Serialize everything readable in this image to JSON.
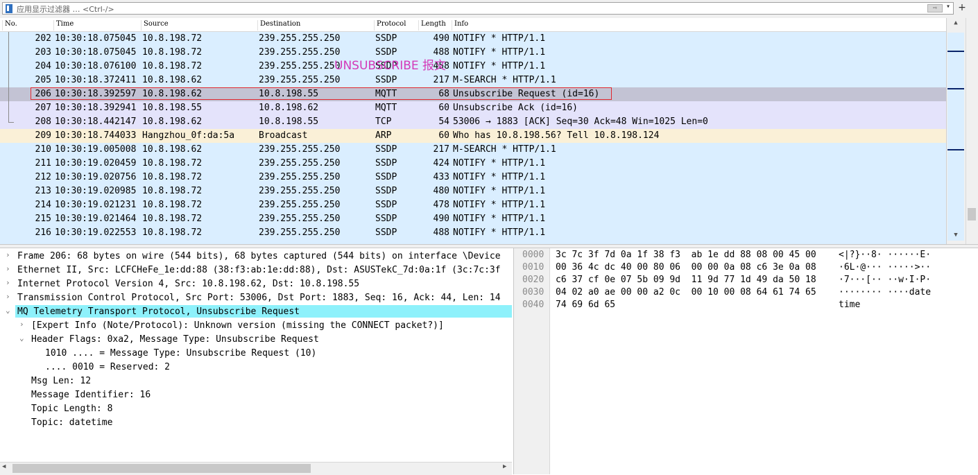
{
  "filter": {
    "placeholder": "应用显示过滤器 … <Ctrl-/>",
    "apply_label": "⇨",
    "add_label": "+"
  },
  "columns": [
    "No.",
    "Time",
    "Source",
    "Destination",
    "Protocol",
    "Length",
    "Info"
  ],
  "packets": [
    {
      "no": "202",
      "time": "10:30:18.075045",
      "src": "10.8.198.72",
      "dst": "239.255.255.250",
      "proto": "SSDP",
      "len": "490",
      "info": "NOTIFY * HTTP/1.1",
      "kind": "ssdp"
    },
    {
      "no": "203",
      "time": "10:30:18.075045",
      "src": "10.8.198.72",
      "dst": "239.255.255.250",
      "proto": "SSDP",
      "len": "488",
      "info": "NOTIFY * HTTP/1.1",
      "kind": "ssdp"
    },
    {
      "no": "204",
      "time": "10:30:18.076100",
      "src": "10.8.198.72",
      "dst": "239.255.255.250",
      "proto": "SSDP",
      "len": "458",
      "info": "NOTIFY * HTTP/1.1",
      "kind": "ssdp"
    },
    {
      "no": "205",
      "time": "10:30:18.372411",
      "src": "10.8.198.62",
      "dst": "239.255.255.250",
      "proto": "SSDP",
      "len": "217",
      "info": "M-SEARCH * HTTP/1.1",
      "kind": "ssdp"
    },
    {
      "no": "206",
      "time": "10:30:18.392597",
      "src": "10.8.198.62",
      "dst": "10.8.198.55",
      "proto": "MQTT",
      "len": "68",
      "info": "Unsubscribe Request (id=16)",
      "kind": "sel"
    },
    {
      "no": "207",
      "time": "10:30:18.392941",
      "src": "10.8.198.55",
      "dst": "10.8.198.62",
      "proto": "MQTT",
      "len": "60",
      "info": "Unsubscribe Ack (id=16)",
      "kind": "mqtt"
    },
    {
      "no": "208",
      "time": "10:30:18.442147",
      "src": "10.8.198.62",
      "dst": "10.8.198.55",
      "proto": "TCP",
      "len": "54",
      "info": "53006 → 1883 [ACK] Seq=30 Ack=48 Win=1025 Len=0",
      "kind": "tcp"
    },
    {
      "no": "209",
      "time": "10:30:18.744033",
      "src": "Hangzhou_0f:da:5a",
      "dst": "Broadcast",
      "proto": "ARP",
      "len": "60",
      "info": "Who has 10.8.198.56? Tell 10.8.198.124",
      "kind": "arp"
    },
    {
      "no": "210",
      "time": "10:30:19.005008",
      "src": "10.8.198.62",
      "dst": "239.255.255.250",
      "proto": "SSDP",
      "len": "217",
      "info": "M-SEARCH * HTTP/1.1",
      "kind": "ssdp"
    },
    {
      "no": "211",
      "time": "10:30:19.020459",
      "src": "10.8.198.72",
      "dst": "239.255.255.250",
      "proto": "SSDP",
      "len": "424",
      "info": "NOTIFY * HTTP/1.1",
      "kind": "ssdp"
    },
    {
      "no": "212",
      "time": "10:30:19.020756",
      "src": "10.8.198.72",
      "dst": "239.255.255.250",
      "proto": "SSDP",
      "len": "433",
      "info": "NOTIFY * HTTP/1.1",
      "kind": "ssdp"
    },
    {
      "no": "213",
      "time": "10:30:19.020985",
      "src": "10.8.198.72",
      "dst": "239.255.255.250",
      "proto": "SSDP",
      "len": "480",
      "info": "NOTIFY * HTTP/1.1",
      "kind": "ssdp"
    },
    {
      "no": "214",
      "time": "10:30:19.021231",
      "src": "10.8.198.72",
      "dst": "239.255.255.250",
      "proto": "SSDP",
      "len": "478",
      "info": "NOTIFY * HTTP/1.1",
      "kind": "ssdp"
    },
    {
      "no": "215",
      "time": "10:30:19.021464",
      "src": "10.8.198.72",
      "dst": "239.255.255.250",
      "proto": "SSDP",
      "len": "490",
      "info": "NOTIFY * HTTP/1.1",
      "kind": "ssdp"
    },
    {
      "no": "216",
      "time": "10:30:19.022553",
      "src": "10.8.198.72",
      "dst": "239.255.255.250",
      "proto": "SSDP",
      "len": "488",
      "info": "NOTIFY * HTTP/1.1",
      "kind": "ssdp"
    }
  ],
  "details": [
    {
      "indent": 0,
      "toggle": "›",
      "text": "Frame 206: 68 bytes on wire (544 bits), 68 bytes captured (544 bits) on interface \\Device"
    },
    {
      "indent": 0,
      "toggle": "›",
      "text": "Ethernet II, Src: LCFCHeFe_1e:dd:88 (38:f3:ab:1e:dd:88), Dst: ASUSTekC_7d:0a:1f (3c:7c:3f"
    },
    {
      "indent": 0,
      "toggle": "›",
      "text": "Internet Protocol Version 4, Src: 10.8.198.62, Dst: 10.8.198.55"
    },
    {
      "indent": 0,
      "toggle": "›",
      "text": "Transmission Control Protocol, Src Port: 53006, Dst Port: 1883, Seq: 16, Ack: 44, Len: 14"
    },
    {
      "indent": 0,
      "toggle": "⌄",
      "text": "MQ Telemetry Transport Protocol, Unsubscribe Request"
    },
    {
      "indent": 1,
      "toggle": "›",
      "text": "[Expert Info (Note/Protocol): Unknown version (missing the CONNECT packet?)]"
    },
    {
      "indent": 1,
      "toggle": "⌄",
      "text": "Header Flags: 0xa2, Message Type: Unsubscribe Request"
    },
    {
      "indent": 2,
      "toggle": "",
      "text": "1010 .... = Message Type: Unsubscribe Request (10)"
    },
    {
      "indent": 2,
      "toggle": "",
      "text": ".... 0010 = Reserved: 2"
    },
    {
      "indent": 1,
      "toggle": "",
      "text": "Msg Len: 12"
    },
    {
      "indent": 1,
      "toggle": "",
      "text": "Message Identifier: 16"
    },
    {
      "indent": 1,
      "toggle": "",
      "text": "Topic Length: 8"
    },
    {
      "indent": 1,
      "toggle": "",
      "text": "Topic: datetime"
    }
  ],
  "annotation": "UNSUBSCRIBE 报文",
  "bytes": [
    {
      "off": "0000",
      "hex": "3c 7c 3f 7d 0a 1f 38 f3  ab 1e dd 88 08 00 45 00",
      "ascii": "<|?}··8· ······E·"
    },
    {
      "off": "0010",
      "hex": "00 36 4c dc 40 00 80 06  00 00 0a 08 c6 3e 0a 08",
      "ascii": "·6L·@··· ·····>··"
    },
    {
      "off": "0020",
      "hex": "c6 37 cf 0e 07 5b 09 9d  11 9d 77 1d 49 da 50 18",
      "ascii": "·7···[·· ··w·I·P·"
    },
    {
      "off": "0030",
      "hex": "04 02 a0 ae 00 00 a2 0c  00 10 00 08 64 61 74 65",
      "ascii": "········ ····date"
    },
    {
      "off": "0040",
      "hex": "74 69 6d 65",
      "ascii": "time"
    }
  ]
}
